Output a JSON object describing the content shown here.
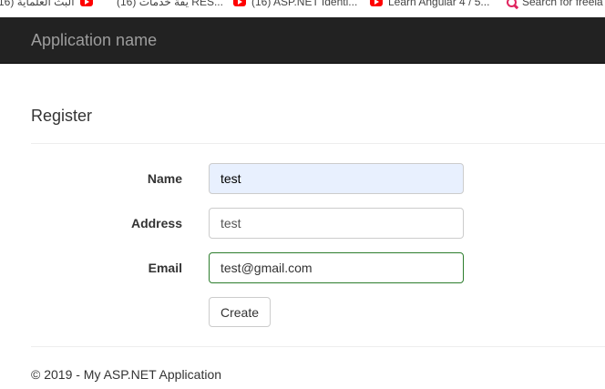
{
  "bookmarks": [
    {
      "label": "(16) البث العلماية",
      "icon": "youtube-icon"
    },
    {
      "label": "(16) يقة خدمات RES...",
      "icon": "youtube-icon"
    },
    {
      "label": "(16) ASP.NET Identi...",
      "icon": "youtube-icon"
    },
    {
      "label": "Learn Angular 4 / 5...",
      "icon": "youtube-icon"
    },
    {
      "label": "Search for freela",
      "icon": "search-icon"
    }
  ],
  "navbar": {
    "brand": "Application name"
  },
  "page": {
    "title": "Register"
  },
  "form": {
    "name": {
      "label": "Name",
      "value": "test"
    },
    "address": {
      "label": "Address",
      "value": "test"
    },
    "email": {
      "label": "Email",
      "value": "test@gmail.com"
    },
    "submit_label": "Create"
  },
  "footer": {
    "text": "© 2019 - My ASP.NET Application"
  },
  "colors": {
    "navbar_bg": "#222222",
    "brand_text": "#9d9d9d",
    "autofill_bg": "#e8f0fe",
    "valid_border": "#2d7d2d"
  }
}
